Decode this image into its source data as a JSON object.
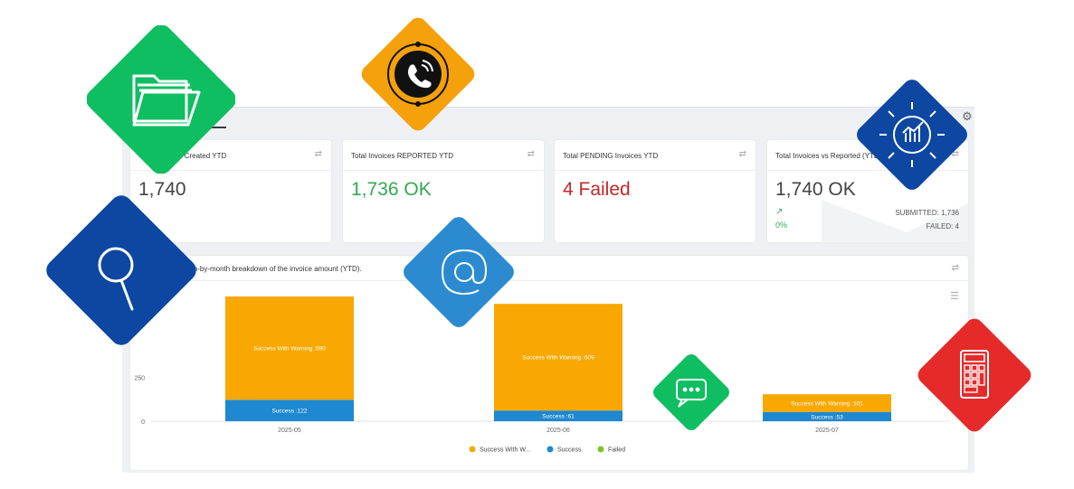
{
  "dashboard": {
    "cards": [
      {
        "title": "Total Invoices Created YTD",
        "value": "1,740",
        "value_color": "#444444"
      },
      {
        "title": "Total Invoices REPORTED YTD",
        "value": "1,736 OK",
        "value_color": "#34a853"
      },
      {
        "title": "Total PENDING Invoices YTD",
        "value": "4 Failed",
        "value_color": "#c62828"
      },
      {
        "title": "Total Invoices vs Reported (YTD)",
        "value": "1,740 OK",
        "value_color": "#444444",
        "trend": "0%",
        "submitted": "SUBMITTED: 1,736",
        "failed": "FAILED: 4"
      }
    ],
    "refresh_icon": "refresh-icon",
    "settings_icon": "gear-icon"
  },
  "chart_panel": {
    "title": "Month-by-month breakdown of the invoice amount (YTD).",
    "menu_icon": "hamburger-icon"
  },
  "chart_data": {
    "type": "bar",
    "stacked": true,
    "categories": [
      "2025-05",
      "2025-06",
      "2025-07"
    ],
    "series": [
      {
        "name": "Success With W...",
        "values": [
          590,
          609,
          101
        ],
        "color": "#f8a800",
        "label_prefix": "Success With Warning"
      },
      {
        "name": "Success",
        "values": [
          122,
          61,
          53
        ],
        "color": "#1e88d0",
        "label_prefix": "Success"
      },
      {
        "name": "Failed",
        "values": [
          0,
          0,
          0
        ],
        "color": "#7cc520"
      }
    ],
    "yticks": [
      "0",
      "250"
    ],
    "ylim": [
      0,
      712
    ],
    "legend": "bottom",
    "grid": false
  },
  "decorations": [
    {
      "icon": "folder-icon",
      "color": "#0fbe61"
    },
    {
      "icon": "phone-call-icon",
      "color": "#f5a10b"
    },
    {
      "icon": "analytics-icon",
      "color": "#0d47a1"
    },
    {
      "icon": "search-icon",
      "color": "#0d47a1"
    },
    {
      "icon": "at-sign-icon",
      "color": "#2c8bd0"
    },
    {
      "icon": "chat-bubble-icon",
      "color": "#0fbe61"
    },
    {
      "icon": "calculator-icon",
      "color": "#e52a2a"
    }
  ]
}
